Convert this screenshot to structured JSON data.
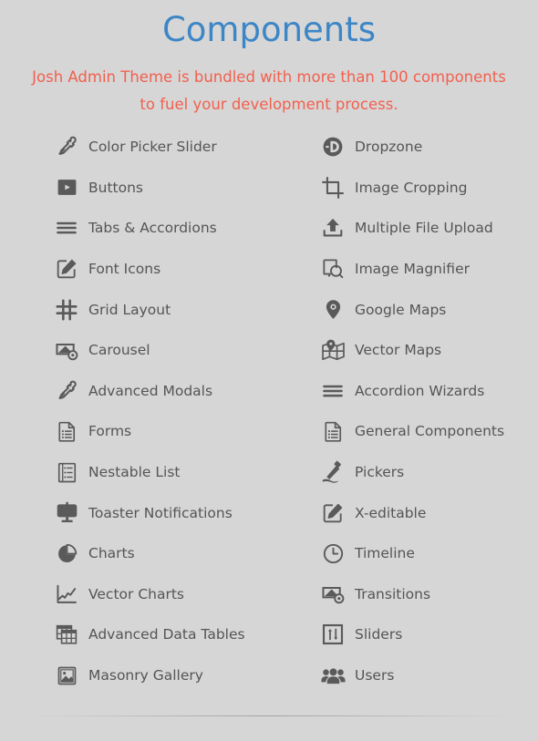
{
  "header": {
    "title": "Components",
    "subtitle": "Josh Admin Theme is bundled with more than 100 components to fuel your development process.",
    "title_color": "#3d86c6",
    "subtitle_color": "#f2604e"
  },
  "theme": {
    "background_color": "#d6d6d6",
    "icon_color": "#5a5a5a",
    "label_color": "#555555"
  },
  "columns": {
    "left": [
      {
        "label": "Color Picker Slider",
        "icon": "eyedropper-icon"
      },
      {
        "label": "Buttons",
        "icon": "play-button-icon"
      },
      {
        "label": "Tabs & Accordions",
        "icon": "hamburger-lines-icon"
      },
      {
        "label": "Font Icons",
        "icon": "pencil-square-icon"
      },
      {
        "label": "Grid Layout",
        "icon": "grid-hash-icon"
      },
      {
        "label": "Carousel",
        "icon": "carousel-screen-icon"
      },
      {
        "label": "Advanced Modals",
        "icon": "eyedropper-icon"
      },
      {
        "label": "Forms",
        "icon": "form-document-icon"
      },
      {
        "label": "Nestable List",
        "icon": "nested-list-icon"
      },
      {
        "label": "Toaster Notifications",
        "icon": "monitor-filled-icon"
      },
      {
        "label": "Charts",
        "icon": "pie-chart-icon"
      },
      {
        "label": "Vector Charts",
        "icon": "line-chart-icon"
      },
      {
        "label": "Advanced Data Tables",
        "icon": "data-table-icon"
      },
      {
        "label": "Masonry Gallery",
        "icon": "image-frame-icon"
      }
    ],
    "right": [
      {
        "label": "Dropzone",
        "icon": "dropzone-logo-icon"
      },
      {
        "label": "Image Cropping",
        "icon": "crop-icon"
      },
      {
        "label": "Multiple File Upload",
        "icon": "upload-arrow-icon"
      },
      {
        "label": "Image Magnifier",
        "icon": "magnifier-page-icon"
      },
      {
        "label": "Google Maps",
        "icon": "map-pin-icon"
      },
      {
        "label": "Vector Maps",
        "icon": "folded-map-icon"
      },
      {
        "label": "Accordion Wizards",
        "icon": "hamburger-lines-icon"
      },
      {
        "label": "General Components",
        "icon": "form-document-icon"
      },
      {
        "label": "Pickers",
        "icon": "pickaxe-icon"
      },
      {
        "label": "X-editable",
        "icon": "pencil-square-icon"
      },
      {
        "label": "Timeline",
        "icon": "clock-icon"
      },
      {
        "label": "Transitions",
        "icon": "carousel-screen-icon"
      },
      {
        "label": "Sliders",
        "icon": "sliders-icon"
      },
      {
        "label": "Users",
        "icon": "users-group-icon"
      }
    ]
  }
}
